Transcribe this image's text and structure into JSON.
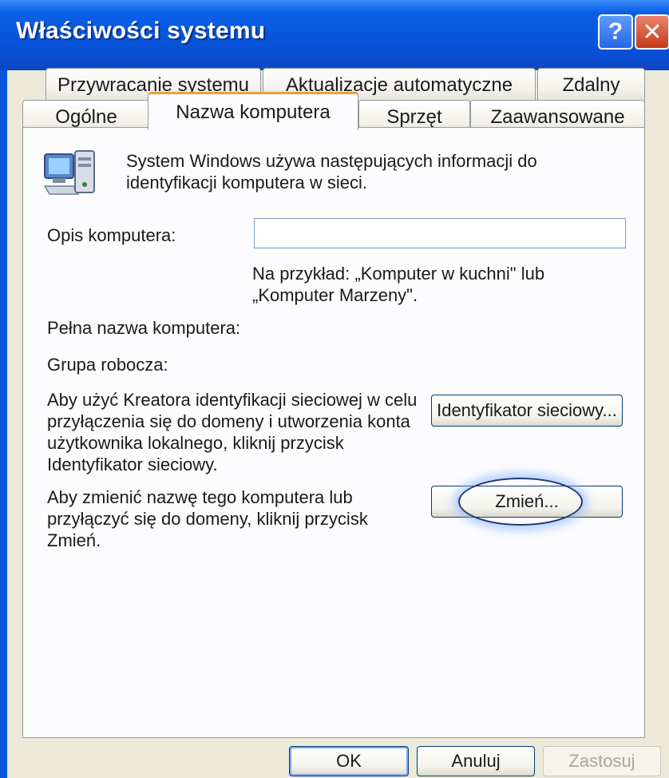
{
  "window": {
    "title": "Właściwości systemu",
    "help_button": "?",
    "close_button": "✕"
  },
  "tabs": {
    "row1": [
      "Przywracanie systemu",
      "Aktualizacje automatyczne",
      "Zdalny"
    ],
    "row2": [
      "Ogólne",
      "Nazwa komputera",
      "Sprzęt",
      "Zaawansowane"
    ],
    "active": "Nazwa komputera"
  },
  "panel": {
    "intro": "System Windows używa następujących informacji do identyfikacji komputera w sieci.",
    "description_label": "Opis komputera:",
    "description_value": "",
    "example": "Na przykład: „Komputer w kuchni\" lub „Komputer Marzeny\".",
    "full_name_label": "Pełna nazwa komputera:",
    "workgroup_label": "Grupa robocza:",
    "network_id_text": "Aby użyć Kreatora identyfikacji sieciowej w celu przyłączenia się do domeny i utworzenia konta użytkownika lokalnego, kliknij przycisk Identyfikator sieciowy.",
    "network_id_button": "Identyfikator sieciowy...",
    "change_text": "Aby zmienić nazwę tego komputera lub przyłączyć się do domeny, kliknij przycisk Zmień.",
    "change_button": "Zmień..."
  },
  "footer": {
    "ok": "OK",
    "cancel": "Anuluj",
    "apply": "Zastosuj"
  },
  "colors": {
    "titlebar": "#0855dd",
    "dialog_bg": "#ece9d8",
    "panel_bg": "#fcfcfe",
    "active_tab_accent": "#e5a23a"
  }
}
